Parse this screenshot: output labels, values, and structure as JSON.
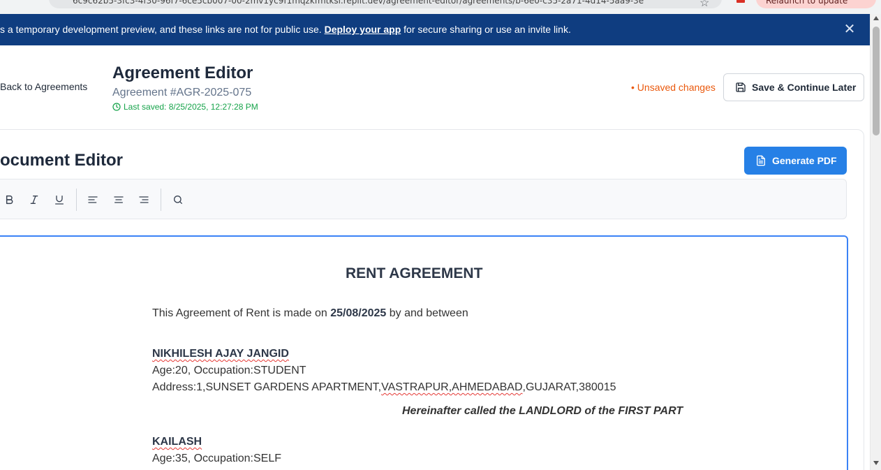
{
  "browser": {
    "url_fragment": "6c9c62b5-3fc3-4f30-96f7-6ce5cb007-00-2mv1yc9f1mqzkfmtksl.replit.dev/agreement-editor/agreements/b-6e0-c35-2a71-4d14-5aa9-3e",
    "relaunch_label": "Relaunch to update"
  },
  "banner": {
    "message_before": "s a temporary development preview, and these links are not for public use. ",
    "link_text": "Deploy your app",
    "message_after": " for secure sharing or use an invite link."
  },
  "header": {
    "back_label": "Back to Agreements",
    "title": "Agreement Editor",
    "agreement_number": "Agreement #AGR-2025-075",
    "last_saved": "Last saved: 8/25/2025, 12:27:28 PM",
    "unsaved_label": "• Unsaved changes",
    "save_button": "Save & Continue Later"
  },
  "editor": {
    "title": "ocument Editor",
    "generate_pdf": "Generate PDF",
    "toolbar": [
      "bold-icon",
      "italic-icon",
      "underline-icon",
      "align-left-icon",
      "align-center-icon",
      "align-right-icon",
      "search-icon"
    ]
  },
  "document": {
    "heading": "RENT AGREEMENT",
    "intro_before": "This Agreement of Rent is made on ",
    "intro_date": "25/08/2025",
    "intro_after": " by and between",
    "landlord": {
      "name": "NIKHILESH AJAY JANGID",
      "details": "Age:20, Occupation:STUDENT",
      "address_prefix": "Address:1,SUNSET GARDENS APARTMENT,",
      "address_misspelled": "VASTRAPUR,AHMEDABAD",
      "address_suffix": ",GUJARAT,380015",
      "role": "Hereinafter called the LANDLORD of the FIRST PART"
    },
    "tenant": {
      "name": "KAILASH",
      "details": "Age:35, Occupation:SELF"
    }
  },
  "colors": {
    "banner": "#0f3d80",
    "primary_button": "#2680e6",
    "unsaved": "#ea580c",
    "saved": "#16a34a",
    "editor_border": "#3b82f6"
  }
}
